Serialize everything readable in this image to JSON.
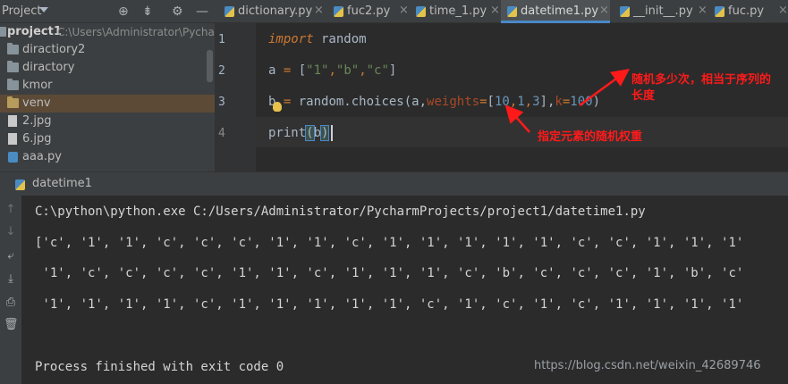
{
  "project_panel": {
    "title": "Project",
    "items": [
      {
        "label": "project1",
        "type": "root"
      },
      {
        "label": "C:\\Users\\Administrator\\Pycharm",
        "type": "path"
      },
      {
        "label": "diractiory2",
        "type": "folder"
      },
      {
        "label": "diractory",
        "type": "folder"
      },
      {
        "label": "kmor",
        "type": "folder"
      },
      {
        "label": "venv",
        "type": "folder"
      },
      {
        "label": "2.jpg",
        "type": "file"
      },
      {
        "label": "6.jpg",
        "type": "file"
      },
      {
        "label": "aaa.py",
        "type": "py"
      }
    ]
  },
  "tabs": [
    {
      "label": "dictionary.py",
      "close": "×"
    },
    {
      "label": "fuc2.py",
      "close": "×"
    },
    {
      "label": "time_1.py",
      "close": "×"
    },
    {
      "label": "datetime1.py",
      "close": "×",
      "active": true
    },
    {
      "label": "__init__.py",
      "close": "×"
    },
    {
      "label": "fuc.py",
      "close": "×"
    }
  ],
  "editor": {
    "line_numbers": [
      "1",
      "2",
      "3",
      "4"
    ],
    "lines": {
      "l1_kw": "import",
      "l1_rest": " random",
      "l2_a": "a ",
      "l2_eq": "=",
      "l2_open": " [",
      "l2_s1": "\"1\"",
      "l2_c1": ",",
      "l2_s2": "\"b\"",
      "l2_c2": ",",
      "l2_s3": "\"c\"",
      "l2_close": "]",
      "l3_b": "b",
      "l3_eq": " =",
      "l3_mid": " random.",
      "l3_fn": "choices",
      "l3_open": "(a,",
      "l3_p1": "weights",
      "l3_eq2": "=",
      "l3_br1": "[",
      "l3_n1": "10",
      "l3_c1": ",",
      "l3_n2": "1",
      "l3_c2": ",",
      "l3_n3": "3",
      "l3_br2": "],",
      "l3_p2": "k",
      "l3_eq3": "=",
      "l3_n4": "100",
      "l3_close": ")",
      "l4_fn": "print",
      "l4_open": "(",
      "l4_arg": "b",
      "l4_close": ")"
    }
  },
  "annotations": {
    "note_k_line1": "随机多少次，相当于序列的",
    "note_k_line2": "长度",
    "note_weights": "指定元素的随机权重",
    "color": "#ff1a1a"
  },
  "run_panel": {
    "tab_label": "datetime1",
    "console_lines": [
      "C:\\python\\python.exe C:/Users/Administrator/PycharmProjects/project1/datetime1.py",
      "['c', '1', '1', 'c', 'c', 'c', '1', '1', 'c', '1', '1', '1', '1', '1', 'c', 'c', '1', '1', '1'",
      " '1', 'c', 'c', 'c', 'c', '1', '1', 'c', '1', '1', '1', 'c', 'b', 'c', 'c', 'c', '1', 'b', 'c'",
      " '1', '1', '1', '1', 'c', '1', '1', '1', '1', '1', 'c', '1', 'c', '1', 'c', '1', '1', '1', '1'",
      "",
      "Process finished with exit code 0"
    ]
  },
  "watermark": "https://blog.csdn.net/weixin_42689746",
  "colors": {
    "keyword": "#cc7832",
    "string": "#6a8759",
    "number": "#6897bb",
    "function": "#ffc66d",
    "param": "#aa4926",
    "active_tab_underline": "#4a88c7"
  }
}
